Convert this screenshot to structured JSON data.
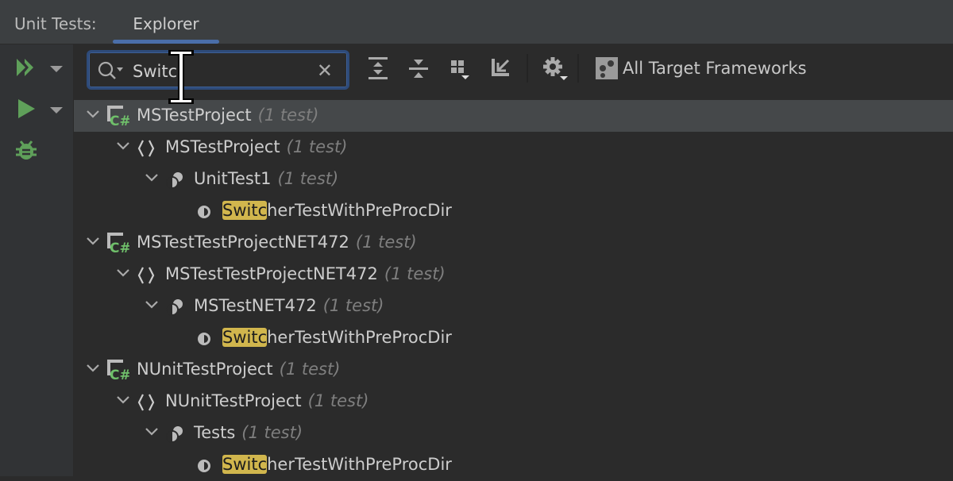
{
  "header": {
    "title": "Unit Tests:",
    "tab": "Explorer"
  },
  "left_toolbar": [
    {
      "name": "run-all-icon",
      "color": "#5fa05a"
    },
    {
      "name": "run-icon",
      "color": "#5fa05a"
    },
    {
      "name": "debug-icon",
      "color": "#5fa05a"
    }
  ],
  "search": {
    "value": "Switc"
  },
  "toolbar": {
    "frameworks_label": "All Target Frameworks"
  },
  "colors": {
    "highlight": "#d1b64d",
    "accent": "#4a6ea9",
    "green": "#5fa05a"
  },
  "tree": [
    {
      "level": 0,
      "icon": "csharp-project",
      "name": "MSTestProject",
      "count": "(1 test)",
      "selected": true
    },
    {
      "level": 1,
      "icon": "namespace",
      "name": "MSTestProject",
      "count": "(1 test)"
    },
    {
      "level": 2,
      "icon": "test-class",
      "name": "UnitTest1",
      "count": "(1 test)"
    },
    {
      "level": 3,
      "icon": "test-method",
      "match": "Switc",
      "rest": "herTestWithPreProcDir"
    },
    {
      "level": 0,
      "icon": "csharp-project",
      "name": "MSTestTestProjectNET472",
      "count": "(1 test)"
    },
    {
      "level": 1,
      "icon": "namespace",
      "name": "MSTestTestProjectNET472",
      "count": "(1 test)"
    },
    {
      "level": 2,
      "icon": "test-class",
      "name": "MSTestNET472",
      "count": "(1 test)"
    },
    {
      "level": 3,
      "icon": "test-method",
      "match": "Switc",
      "rest": "herTestWithPreProcDir"
    },
    {
      "level": 0,
      "icon": "csharp-project",
      "name": "NUnitTestProject",
      "count": "(1 test)"
    },
    {
      "level": 1,
      "icon": "namespace",
      "name": "NUnitTestProject",
      "count": "(1 test)"
    },
    {
      "level": 2,
      "icon": "test-class",
      "name": "Tests",
      "count": "(1 test)"
    },
    {
      "level": 3,
      "icon": "test-method",
      "match": "Switc",
      "rest": "herTestWithPreProcDir"
    }
  ]
}
